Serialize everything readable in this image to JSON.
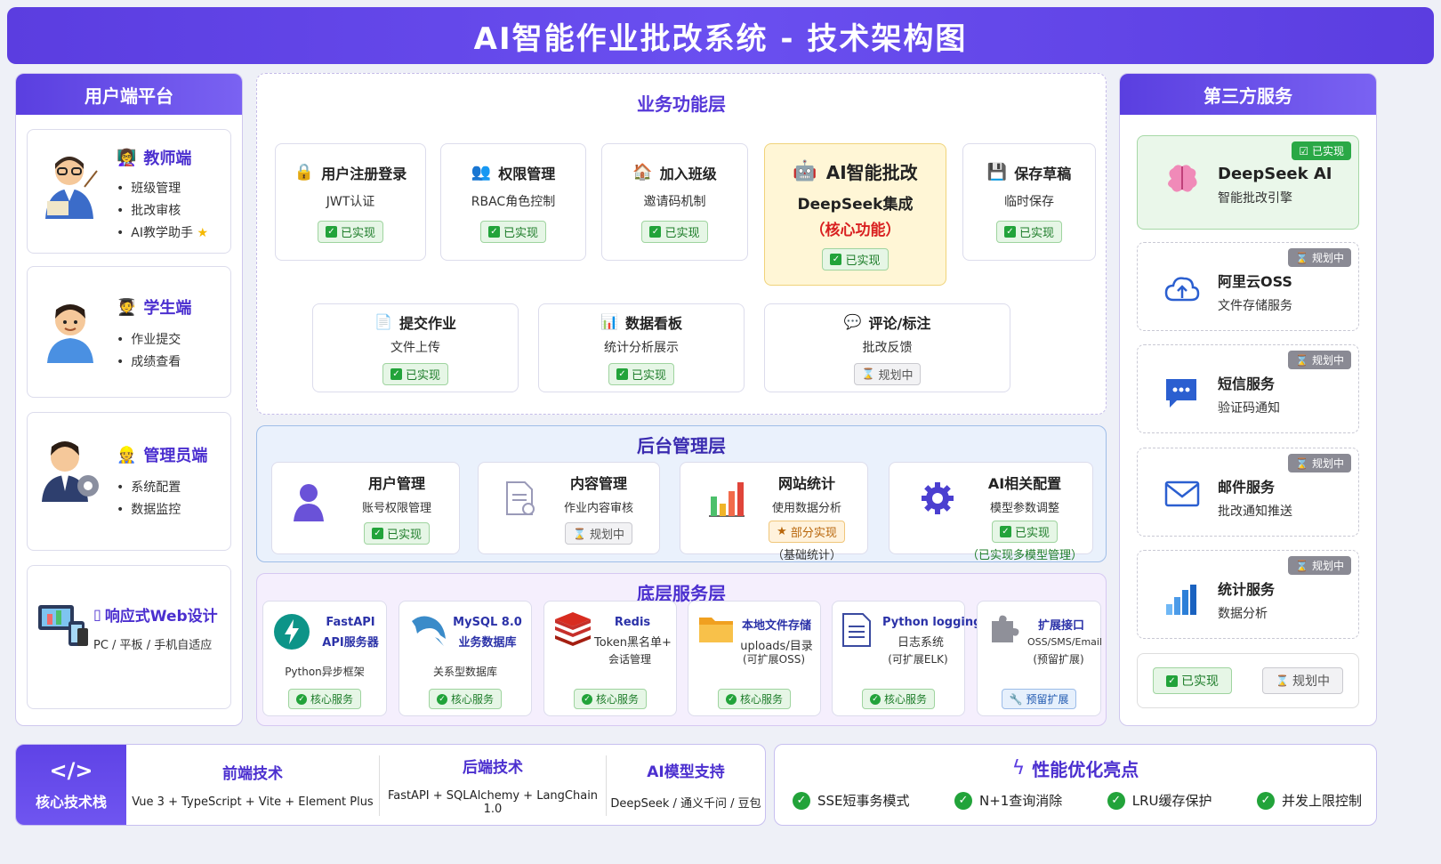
{
  "title": "AI智能作业批改系统 - 技术架构图",
  "left": {
    "header": "用户端平台",
    "teacher": {
      "title": "教师端",
      "items": [
        "班级管理",
        "批改审核",
        "AI教学助手"
      ]
    },
    "student": {
      "title": "学生端",
      "items": [
        "作业提交",
        "成绩查看"
      ]
    },
    "admin": {
      "title": "管理员端",
      "items": [
        "系统配置",
        "数据监控"
      ]
    },
    "responsive": {
      "title": "响应式Web设计",
      "sub": "PC / 平板 / 手机自适应"
    }
  },
  "business": {
    "title": "业务功能层",
    "row1": [
      {
        "icon": "lock-icon",
        "title": "用户注册登录",
        "sub": "JWT认证",
        "status": "已实现"
      },
      {
        "icon": "users-icon",
        "title": "权限管理",
        "sub": "RBAC角色控制",
        "status": "已实现"
      },
      {
        "icon": "house-icon",
        "title": "加入班级",
        "sub": "邀请码机制",
        "status": "已实现"
      },
      {
        "icon": "robot-icon",
        "title": "AI智能批改",
        "sub": "DeepSeek集成",
        "note": "（核心功能）",
        "status": "已实现"
      },
      {
        "icon": "save-icon",
        "title": "保存草稿",
        "sub": "临时保存",
        "status": "已实现"
      }
    ],
    "row2": [
      {
        "icon": "document-icon",
        "title": "提交作业",
        "sub": "文件上传",
        "status": "已实现"
      },
      {
        "icon": "bar-chart-icon",
        "title": "数据看板",
        "sub": "统计分析展示",
        "status": "已实现"
      },
      {
        "icon": "comment-icon",
        "title": "评论/标注",
        "sub": "批改反馈",
        "status": "规划中"
      }
    ]
  },
  "backend": {
    "title": "后台管理层",
    "items": [
      {
        "icon": "user-icon",
        "title": "用户管理",
        "sub": "账号权限管理",
        "status": "已实现"
      },
      {
        "icon": "content-icon",
        "title": "内容管理",
        "sub": "作业内容审核",
        "status": "规划中"
      },
      {
        "icon": "stats-icon",
        "title": "网站统计",
        "sub": "使用数据分析",
        "status": "部分实现",
        "note": "（基础统计）"
      },
      {
        "icon": "gear-icon",
        "title": "AI相关配置",
        "sub": "模型参数调整",
        "status": "已实现",
        "note": "（已实现多模型管理）"
      }
    ]
  },
  "base": {
    "title": "底层服务层",
    "items": [
      {
        "icon": "fastapi-icon",
        "title1": "FastAPI",
        "title2": "API服务器",
        "sub": "Python异步框架",
        "tag": "核心服务"
      },
      {
        "icon": "mysql-dolphin-icon",
        "title1": "MySQL 8.0",
        "title2": "业务数据库",
        "sub": "关系型数据库",
        "tag": "核心服务"
      },
      {
        "icon": "redis-icon",
        "title1": "Redis",
        "title2": "Token黑名单+",
        "sub": "会话管理",
        "tag": "核心服务"
      },
      {
        "icon": "folder-icon",
        "title1": "本地文件存储",
        "title2": "uploads/目录",
        "sub": "(可扩展OSS)",
        "tag": "核心服务"
      },
      {
        "icon": "log-icon",
        "title1": "Python logging",
        "title2": "日志系统",
        "sub": "(可扩展ELK)",
        "tag": "核心服务"
      },
      {
        "icon": "puzzle-icon",
        "title1": "扩展接口",
        "title2": "OSS/SMS/Email",
        "sub": "(预留扩展)",
        "tag": "预留扩展"
      }
    ]
  },
  "right": {
    "header": "第三方服务",
    "items": [
      {
        "icon": "brain-icon",
        "title": "DeepSeek AI",
        "sub": "智能批改引擎",
        "badge": "已实现"
      },
      {
        "icon": "cloud-icon",
        "title": "阿里云OSS",
        "sub": "文件存储服务",
        "badge": "规划中"
      },
      {
        "icon": "sms-icon",
        "title": "短信服务",
        "sub": "验证码通知",
        "badge": "规划中"
      },
      {
        "icon": "mail-icon",
        "title": "邮件服务",
        "sub": "批改通知推送",
        "badge": "规划中"
      },
      {
        "icon": "chart-icon",
        "title": "统计服务",
        "sub": "数据分析",
        "badge": "规划中"
      }
    ],
    "legend": {
      "ok": "已实现",
      "plan": "规划中"
    }
  },
  "stack": {
    "label": "核心技术栈",
    "columns": [
      {
        "title": "前端技术",
        "sub": "Vue 3 + TypeScript + Vite + Element Plus"
      },
      {
        "title": "后端技术",
        "sub": "FastAPI + SQLAlchemy + LangChain 1.0"
      },
      {
        "title": "AI模型支持",
        "sub": "DeepSeek / 通义千问 / 豆包"
      }
    ]
  },
  "perf": {
    "title": "性能优化亮点",
    "items": [
      "SSE短事务模式",
      "N+1查询消除",
      "LRU缓存保护",
      "并发上限控制"
    ]
  },
  "colors": {
    "primary": "#5b3de0",
    "ok": "#22a33a",
    "core": "#fff6d6",
    "accent_red": "#d92020"
  }
}
